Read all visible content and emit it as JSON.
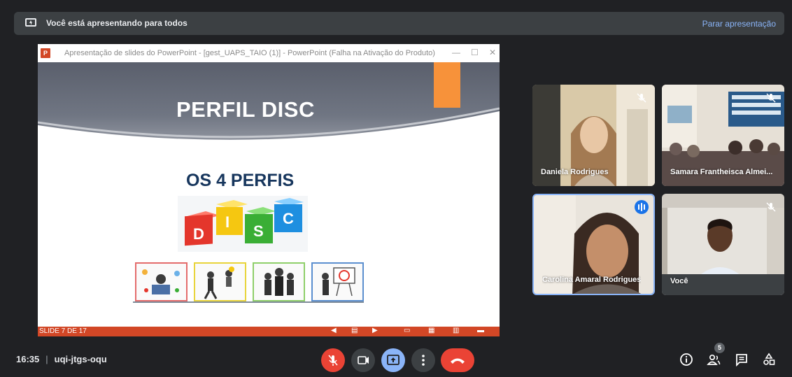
{
  "banner": {
    "message": "Você está apresentando para todos",
    "stop_label": "Parar apresentação"
  },
  "presentation": {
    "window_title": "Apresentação de slides do PowerPoint - [gest_UAPS_TAIO (1)] - PowerPoint (Falha na Ativação do Produto)",
    "app_logo": "P",
    "slide_title": "PERFIL DISC",
    "slide_subtitle": "OS 4 PERFIS",
    "disc_letters": [
      "D",
      "I",
      "S",
      "C"
    ],
    "slide_counter": "SLIDE 7 DE 17",
    "accent_color": "#d24726",
    "orange": "#f7923a"
  },
  "participants": [
    {
      "name": "Daniela Rodrigues",
      "muted": true
    },
    {
      "name": "Samara Frantheisca Almei...",
      "muted": true
    },
    {
      "name": "Carolina Amaral Rodrigues",
      "muted": false,
      "speaking": true
    },
    {
      "name": "Você",
      "muted": true
    }
  ],
  "bottom_bar": {
    "time": "16:35",
    "meeting_code": "uqi-jtgs-oqu",
    "participant_count": "5"
  },
  "icons": [
    "present-icon",
    "mic-off-icon",
    "camera-icon",
    "present-now-icon",
    "more-options-icon",
    "hang-up-icon",
    "info-icon",
    "people-icon",
    "chat-icon",
    "activities-icon"
  ]
}
